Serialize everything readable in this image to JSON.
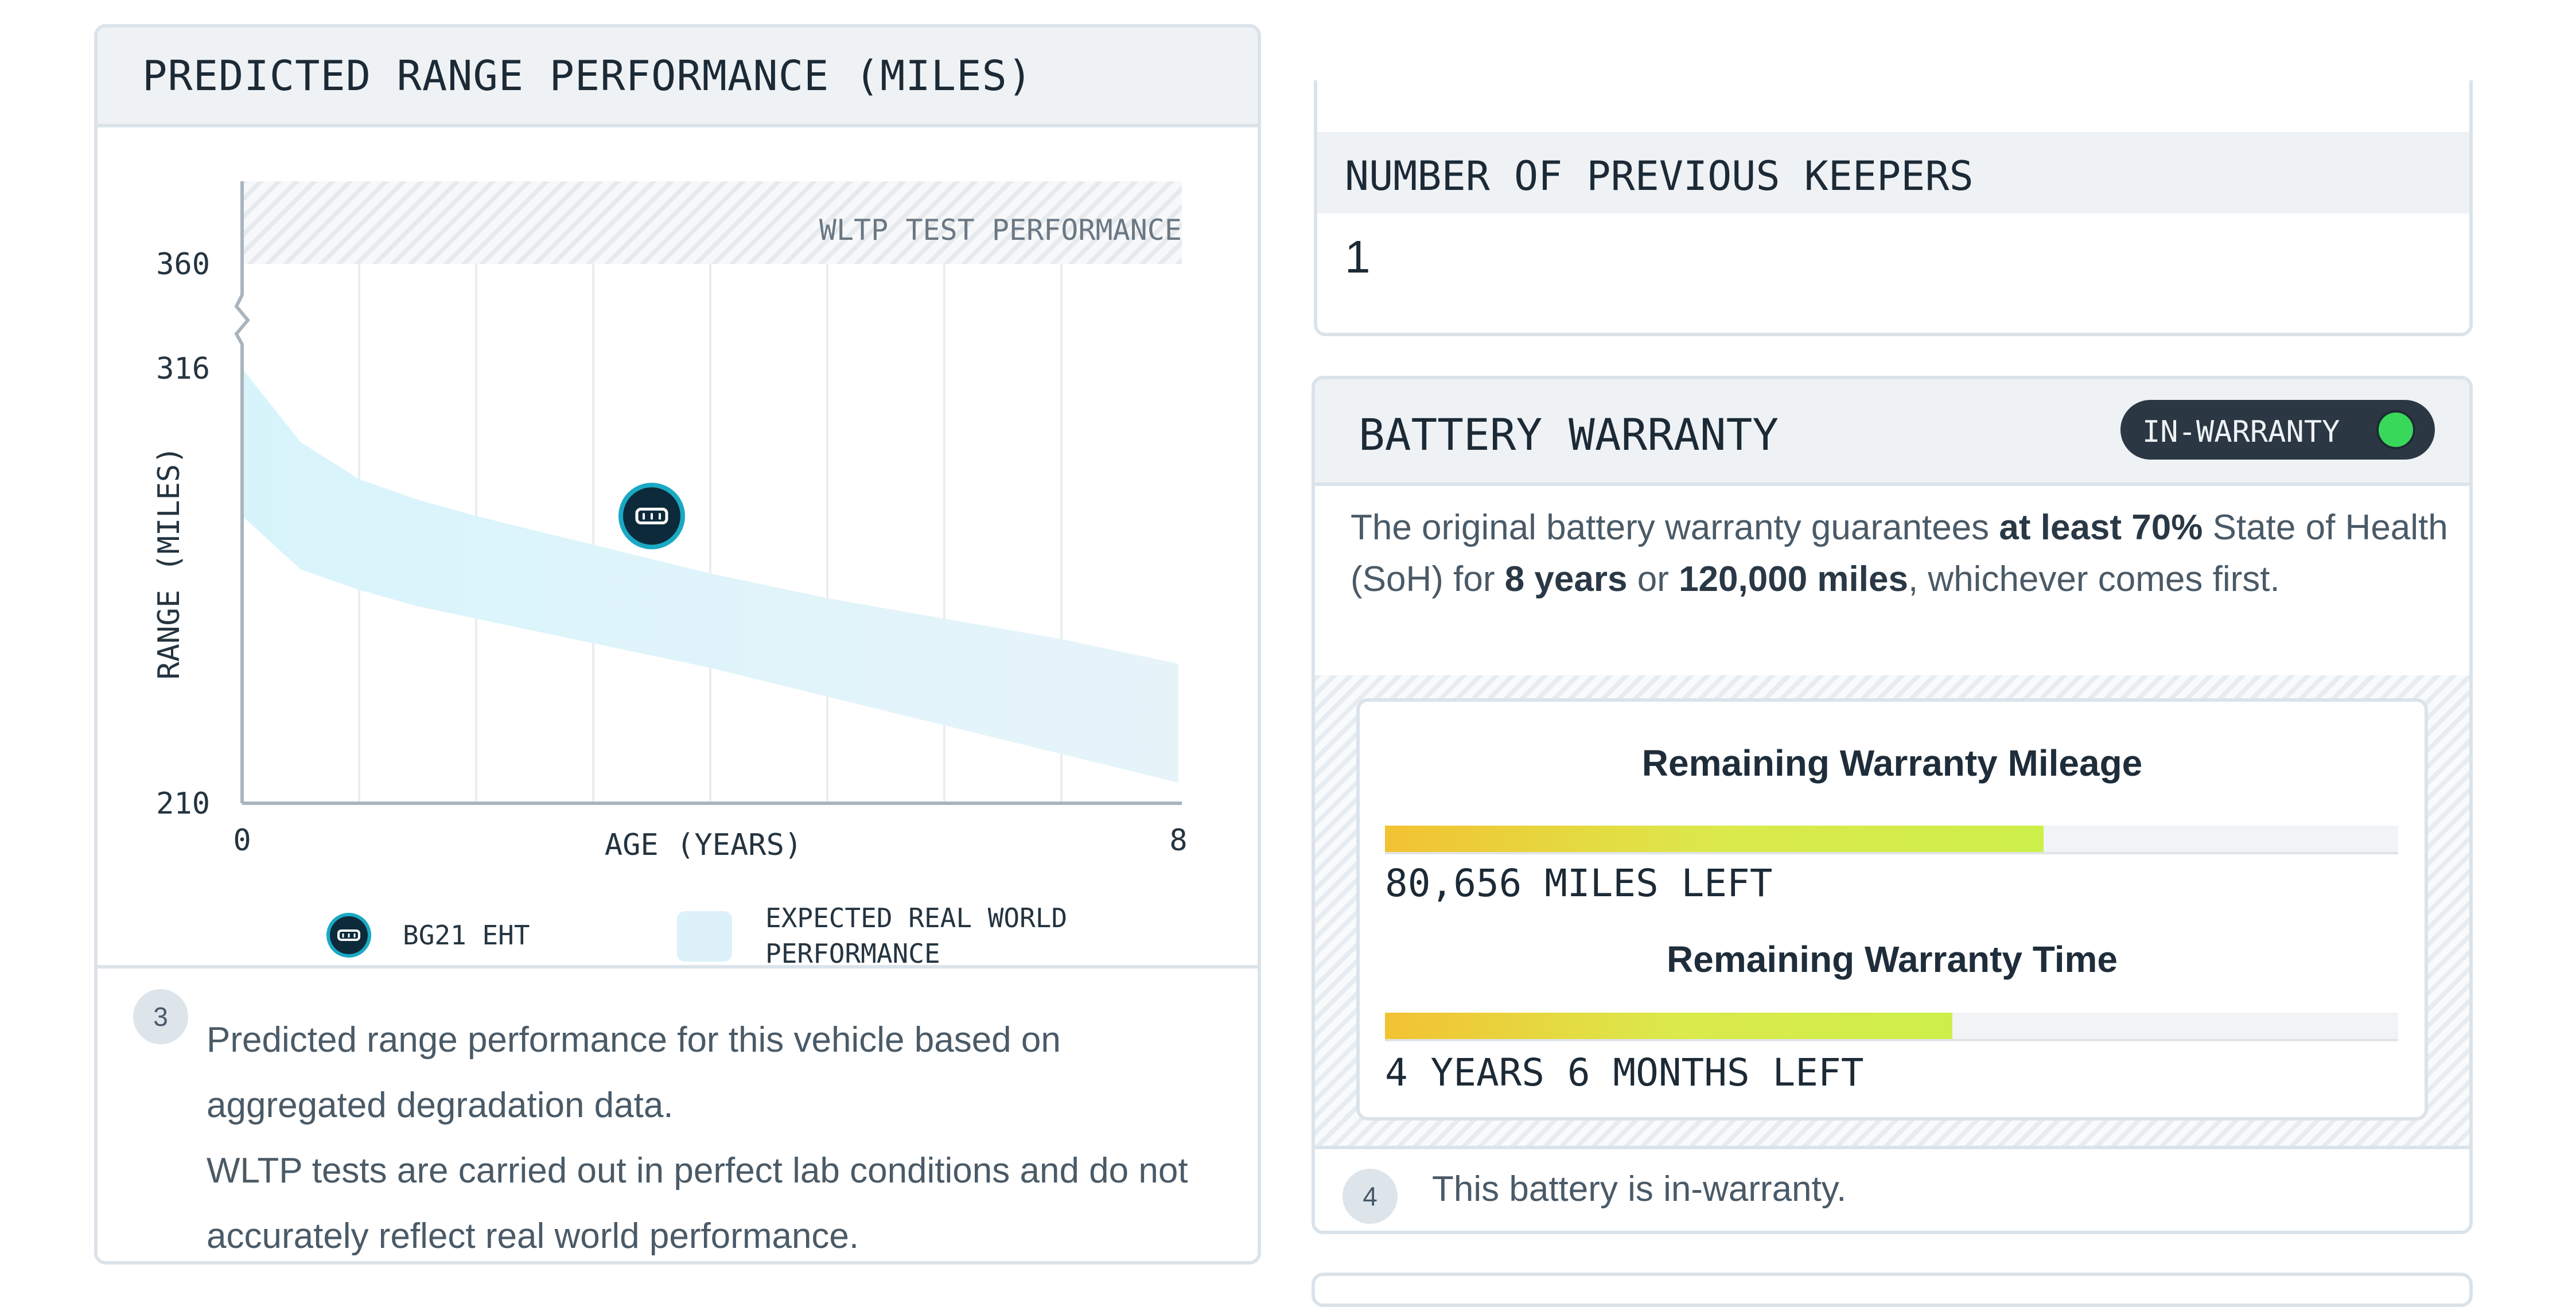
{
  "range_card": {
    "title": "PREDICTED RANGE PERFORMANCE (MILES)",
    "chart": {
      "wltp_label": "WLTP TEST PERFORMANCE",
      "y_ticks": [
        "360",
        "316",
        "210"
      ],
      "x_ticks": [
        "0",
        "8"
      ],
      "xlabel": "AGE (YEARS)",
      "ylabel": "RANGE (MILES)",
      "legend_vehicle": "BG21 EHT",
      "legend_band_line1": "EXPECTED REAL WORLD",
      "legend_band_line2": "PERFORMANCE",
      "marker_icon": "car-icon"
    },
    "step_number": "3",
    "note_line1": "Predicted range performance for this vehicle based on aggregated degradation data.",
    "note_line2": "WLTP tests are carried out in perfect lab conditions and do not accurately reflect real world performance."
  },
  "chart_data": {
    "type": "area",
    "title": "PREDICTED RANGE PERFORMANCE (MILES)",
    "xlabel": "AGE (YEARS)",
    "ylabel": "RANGE (MILES)",
    "xlim": [
      0,
      8
    ],
    "ylim": [
      210,
      360
    ],
    "y_ticks": [
      210,
      316,
      360
    ],
    "x_ticks": [
      0,
      8
    ],
    "grid": "vertical",
    "wltp_value": 360,
    "series": [
      {
        "name": "EXPECTED REAL WORLD PERFORMANCE",
        "x": [
          0,
          0.5,
          1,
          1.5,
          2,
          3,
          4,
          5,
          6,
          7,
          8
        ],
        "upper": [
          316,
          298,
          289,
          284,
          280,
          273,
          266,
          260,
          255,
          250,
          244
        ],
        "lower": [
          280,
          267,
          262,
          258,
          255,
          249,
          243,
          236,
          229,
          222,
          215
        ]
      },
      {
        "name": "BG21 EHT",
        "x": [
          3.5
        ],
        "y": [
          280
        ]
      }
    ]
  },
  "keepers_card": {
    "title": "NUMBER OF PREVIOUS KEEPERS",
    "value": "1"
  },
  "warranty_card": {
    "title": "BATTERY WARRANTY",
    "badge": "IN-WARRANTY",
    "badge_color": "#38d85a",
    "desc_1": "The original battery warranty guarantees ",
    "desc_b1": "at least 70%",
    "desc_2": " State of Health (SoH) for ",
    "desc_b2": "8 years",
    "desc_3": " or ",
    "desc_b3": "120,000 miles",
    "desc_4": ", whichever comes first.",
    "mileage_title": "Remaining Warranty Mileage",
    "mileage_fraction": 0.65,
    "mileage_label": "80,656 MILES LEFT",
    "time_title": "Remaining Warranty Time",
    "time_fraction": 0.56,
    "time_label": "4 YEARS 6 MONTHS LEFT",
    "step_number": "4",
    "note": "This battery is in-warranty."
  }
}
